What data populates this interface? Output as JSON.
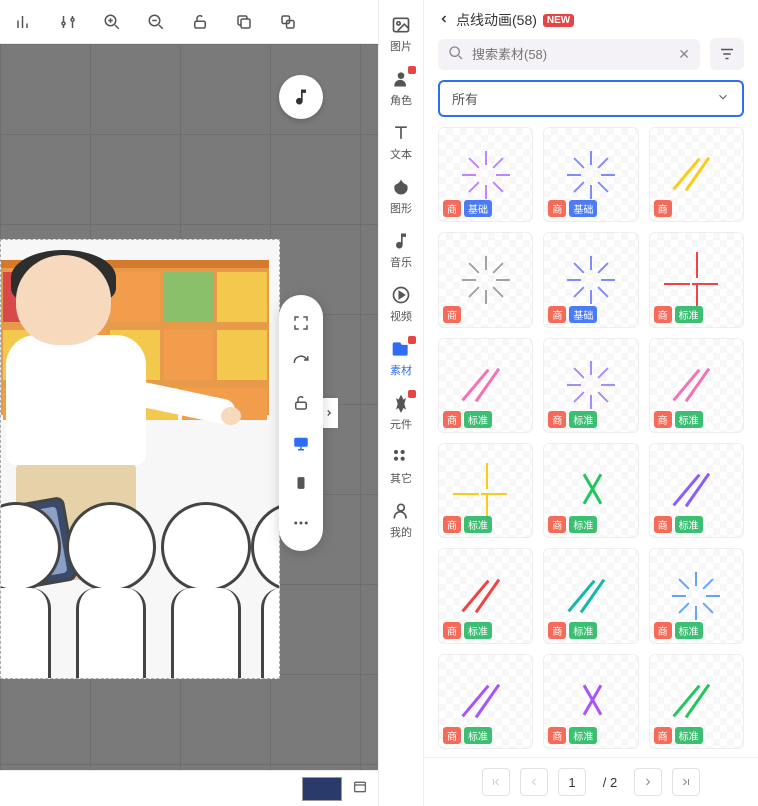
{
  "toolbar": {
    "icons": [
      "bar-chart",
      "sliders",
      "zoom-in",
      "zoom-out",
      "unlock",
      "copy",
      "paste"
    ]
  },
  "music_btn": "音符",
  "float_tools": [
    {
      "name": "fullscreen",
      "active": false
    },
    {
      "name": "rotate",
      "active": false
    },
    {
      "name": "unlock",
      "active": false
    },
    {
      "name": "desktop",
      "active": true
    },
    {
      "name": "mobile",
      "active": false
    },
    {
      "name": "more",
      "active": false
    }
  ],
  "nav": {
    "items": [
      {
        "id": "image",
        "label": "图片",
        "new": false
      },
      {
        "id": "role",
        "label": "角色",
        "new": true
      },
      {
        "id": "text",
        "label": "文本",
        "new": false
      },
      {
        "id": "shape",
        "label": "图形",
        "new": false
      },
      {
        "id": "music",
        "label": "音乐",
        "new": false
      },
      {
        "id": "video",
        "label": "视频",
        "new": false
      },
      {
        "id": "material",
        "label": "素材",
        "new": true,
        "active": true
      },
      {
        "id": "component",
        "label": "元件",
        "new": true
      },
      {
        "id": "other",
        "label": "其它",
        "new": false
      },
      {
        "id": "mine",
        "label": "我的",
        "new": false
      }
    ]
  },
  "panel": {
    "title": "点线动画(58)",
    "new_label": "NEW",
    "search_placeholder": "搜索素材(58)",
    "dropdown_selected": "所有",
    "badge_shang": "商",
    "badge_jichu": "基础",
    "badge_biaozhun": "标准",
    "items": [
      {
        "style": "burst",
        "color": "#c084fc",
        "badges": [
          "shang",
          "jichu"
        ]
      },
      {
        "style": "burst",
        "color": "#818cf8",
        "badges": [
          "shang",
          "jichu"
        ]
      },
      {
        "style": "diag",
        "color": "#facc15",
        "badges": [
          "shang"
        ]
      },
      {
        "style": "burst",
        "color": "#a3a3a3",
        "badges": [
          "shang"
        ]
      },
      {
        "style": "burst",
        "color": "#818cf8",
        "badges": [
          "shang",
          "jichu"
        ]
      },
      {
        "style": "cross",
        "color": "#ef4444",
        "badges": [
          "shang",
          "biaozhun"
        ]
      },
      {
        "style": "diag",
        "color": "#f472b6",
        "badges": [
          "shang",
          "biaozhun"
        ]
      },
      {
        "style": "burst",
        "color": "#a78bfa",
        "badges": [
          "shang",
          "biaozhun"
        ]
      },
      {
        "style": "diag",
        "color": "#f472b6",
        "badges": [
          "shang",
          "biaozhun"
        ]
      },
      {
        "style": "cross",
        "color": "#facc15",
        "badges": [
          "shang",
          "biaozhun"
        ]
      },
      {
        "style": "vshape",
        "color": "#22c55e",
        "badges": [
          "shang",
          "biaozhun"
        ]
      },
      {
        "style": "diag",
        "color": "#8b5cf6",
        "badges": [
          "shang",
          "biaozhun"
        ]
      },
      {
        "style": "diag",
        "color": "#ef4444",
        "badges": [
          "shang",
          "biaozhun"
        ]
      },
      {
        "style": "diag",
        "color": "#14b8a6",
        "badges": [
          "shang",
          "biaozhun"
        ]
      },
      {
        "style": "burst",
        "color": "#60a5fa",
        "badges": [
          "shang",
          "biaozhun"
        ]
      },
      {
        "style": "diag",
        "color": "#a855f7",
        "badges": [
          "shang",
          "biaozhun"
        ]
      },
      {
        "style": "vshape",
        "color": "#a855f7",
        "badges": [
          "shang",
          "biaozhun"
        ]
      },
      {
        "style": "diag",
        "color": "#22c55e",
        "badges": [
          "shang",
          "biaozhun"
        ]
      }
    ]
  },
  "pager": {
    "current": "1",
    "total_label": "/ 2"
  }
}
